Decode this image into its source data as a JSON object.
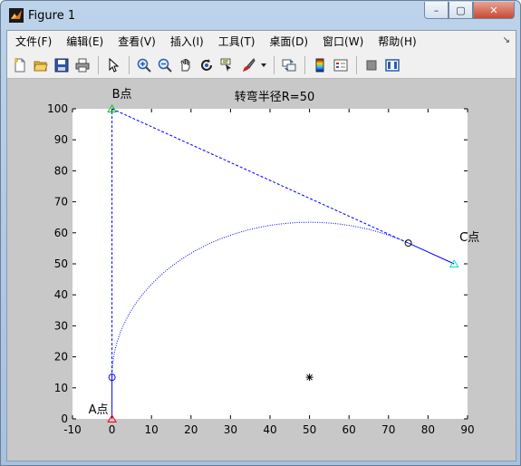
{
  "window": {
    "title": "Figure 1",
    "controls": {
      "minimize": "–",
      "maximize": "▢",
      "close": "✕"
    }
  },
  "menubar": {
    "items": [
      "文件(F)",
      "编辑(E)",
      "查看(V)",
      "插入(I)",
      "工具(T)",
      "桌面(D)",
      "窗口(W)",
      "帮助(H)"
    ],
    "overflow_glyph": "↘"
  },
  "toolbar": {
    "icons": [
      "new-file-icon",
      "open-folder-icon",
      "save-icon",
      "print-icon",
      "pointer-icon",
      "zoom-in-icon",
      "zoom-out-icon",
      "pan-hand-icon",
      "rotate-3d-icon",
      "data-cursor-icon",
      "brush-icon",
      "brush-dropdown-icon",
      "link-plot-icon",
      "colorbar-icon",
      "legend-icon",
      "hide-plot-tools-icon",
      "show-plot-tools-icon"
    ]
  },
  "chart_data": {
    "type": "line",
    "title": "转弯半径R=50",
    "xlabel": "",
    "ylabel": "",
    "xlim": [
      -10,
      90
    ],
    "ylim": [
      0,
      100
    ],
    "xticks": [
      -10,
      0,
      10,
      20,
      30,
      40,
      50,
      60,
      70,
      80,
      90
    ],
    "yticks": [
      0,
      10,
      20,
      30,
      40,
      50,
      60,
      70,
      80,
      90,
      100
    ],
    "xtick_labels": [
      "-10",
      "0",
      "10",
      "20",
      "30",
      "40",
      "50",
      "60",
      "70",
      "80",
      "90"
    ],
    "ytick_labels": [
      "0",
      "10",
      "20",
      "30",
      "40",
      "50",
      "60",
      "70",
      "80",
      "90",
      "100"
    ],
    "grid": false,
    "points": {
      "A": {
        "label": "A点",
        "x": 0,
        "y": 0,
        "marker": "triangle",
        "color": "#ff0000"
      },
      "B": {
        "label": "B点",
        "x": 0,
        "y": 100,
        "marker": "triangle",
        "color": "#00cc00"
      },
      "C": {
        "label": "C点",
        "x": 86.6,
        "y": 50,
        "marker": "triangle",
        "color": "#00e0e0"
      }
    },
    "tangent_points": [
      {
        "x": 0,
        "y": 13.4,
        "marker": "circle"
      },
      {
        "x": 75,
        "y": 56.7,
        "marker": "circle"
      }
    ],
    "center": {
      "x": 50,
      "y": 13.4,
      "marker": "star"
    },
    "arc": {
      "cx": 50,
      "cy": 13.4,
      "r": 50,
      "start_deg": 180,
      "end_deg": 60,
      "style": "dotted"
    },
    "series": [
      {
        "style": "dashed",
        "x": [
          0,
          0
        ],
        "y": [
          13.4,
          100
        ]
      },
      {
        "style": "dashed",
        "x": [
          0,
          75
        ],
        "y": [
          100,
          56.7
        ]
      },
      {
        "style": "solid",
        "x": [
          0,
          0
        ],
        "y": [
          0,
          13.4
        ]
      },
      {
        "style": "solid",
        "x": [
          75,
          86.6
        ],
        "y": [
          56.7,
          50
        ]
      }
    ],
    "line_color": "#0000ff"
  }
}
